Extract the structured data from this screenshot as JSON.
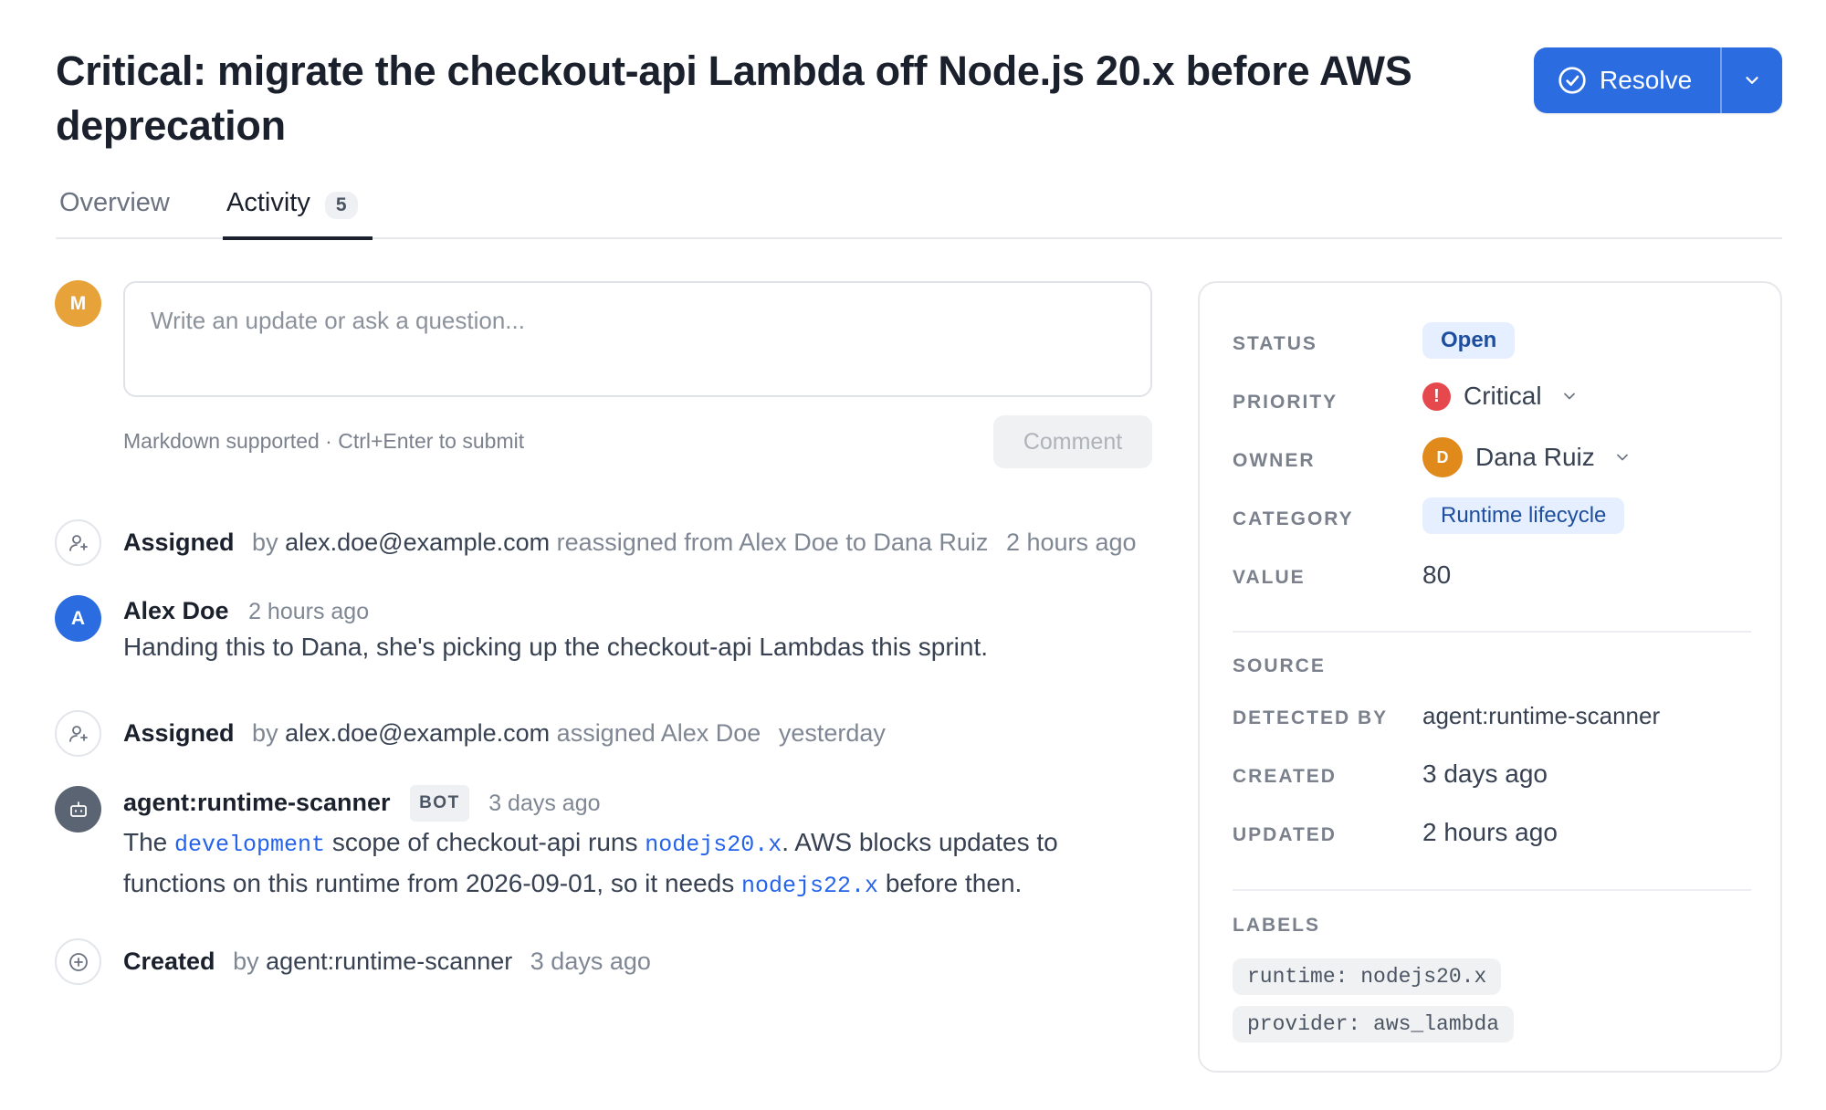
{
  "header": {
    "title": "Critical: migrate the checkout-api Lambda off Node.js 20.x before AWS deprecation",
    "resolve_label": "Resolve"
  },
  "tabs": [
    {
      "label": "Overview"
    },
    {
      "label": "Activity",
      "count": "5"
    }
  ],
  "composer": {
    "avatar_initial": "M",
    "placeholder": "Write an update or ask a question...",
    "helper": "Markdown supported · Ctrl+Enter to submit",
    "submit_label": "Comment"
  },
  "activity": [
    {
      "type": "assigned",
      "action": "Assigned",
      "by_prefix": "by",
      "actor": "alex.doe@example.com",
      "detail": "reassigned from Alex Doe to Dana Ruiz",
      "time": "2 hours ago"
    },
    {
      "type": "comment",
      "avatar_initial": "A",
      "author": "Alex Doe",
      "time": "2 hours ago",
      "body": "Handing this to Dana, she's picking up the checkout-api Lambdas this sprint."
    },
    {
      "type": "assigned",
      "action": "Assigned",
      "by_prefix": "by",
      "actor": "alex.doe@example.com",
      "detail": "assigned Alex Doe",
      "time": "yesterday"
    },
    {
      "type": "bot_comment",
      "author": "agent:runtime-scanner",
      "badge": "BOT",
      "time": "3 days ago",
      "body_parts": {
        "p1": "The ",
        "c1": "development",
        "p2": " scope of checkout-api runs ",
        "c2": "nodejs20.x",
        "p3": ". AWS blocks updates to",
        "p4": "functions on this runtime from 2026-09-01, so it needs ",
        "c3": "nodejs22.x",
        "p5": " before then."
      }
    },
    {
      "type": "created",
      "action": "Created",
      "by_prefix": "by",
      "actor": "agent:runtime-scanner",
      "time": "3 days ago"
    }
  ],
  "properties": {
    "status_label": "STATUS",
    "status": "Open",
    "priority_label": "PRIORITY",
    "priority": "Critical",
    "priority_icon": "!",
    "owner_label": "OWNER",
    "owner": "Dana Ruiz",
    "owner_initial": "D",
    "category_label": "CATEGORY",
    "category": "Runtime lifecycle",
    "value_label": "VALUE",
    "value": "80",
    "source_heading": "SOURCE",
    "detected_by_label": "DETECTED BY",
    "detected_by": "agent:runtime-scanner",
    "created_label": "CREATED",
    "created": "3 days ago",
    "updated_label": "UPDATED",
    "updated": "2 hours ago",
    "labels_heading": "LABELS",
    "labels": [
      "runtime: nodejs20.x",
      "provider: aws_lambda"
    ]
  },
  "colors": {
    "accent": "#2b6de0",
    "critical": "#e5484d",
    "pill_bg": "#e5efff",
    "pill_text": "#1d4f9e"
  }
}
